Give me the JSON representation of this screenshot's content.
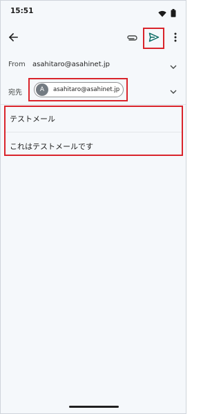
{
  "status_bar": {
    "time": "15:51",
    "icons": [
      "wifi-icon",
      "battery-icon"
    ]
  },
  "toolbar": {
    "back_icon": "arrow-left-icon",
    "attach_icon": "paperclip-icon",
    "send_icon": "send-icon",
    "more_icon": "more-vertical-icon"
  },
  "from": {
    "label": "From",
    "value": "asahitaro@asahinet.jp"
  },
  "to": {
    "label": "宛先",
    "chip_initial": "A",
    "chip_email": "asahitaro@asahinet.jp"
  },
  "compose": {
    "subject": "テストメール",
    "body": "これはテストメールです"
  },
  "colors": {
    "highlight": "#d9232a",
    "send_accent": "#0b6b63",
    "background": "#f5f8fb"
  }
}
